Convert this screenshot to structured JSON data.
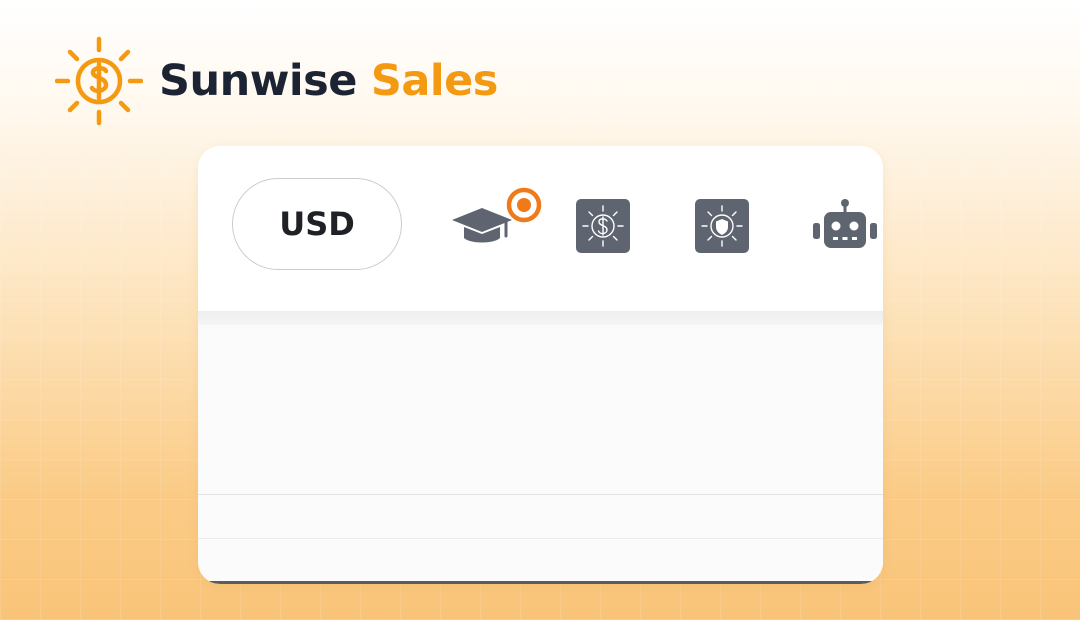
{
  "brand": {
    "name_part1": "Sunwise",
    "name_part2": "Sales",
    "colors": {
      "dark": "#1c2434",
      "accent": "#f39a12"
    },
    "logo_icon": "sun-dollar-icon"
  },
  "toolbar": {
    "currency_label": "USD",
    "icons": [
      "graduation-cap-icon",
      "solar-dollar-icon",
      "solar-shield-icon",
      "robot-icon"
    ],
    "notification_dot_color": "#f07a1a",
    "icon_color": "#5f6570"
  }
}
